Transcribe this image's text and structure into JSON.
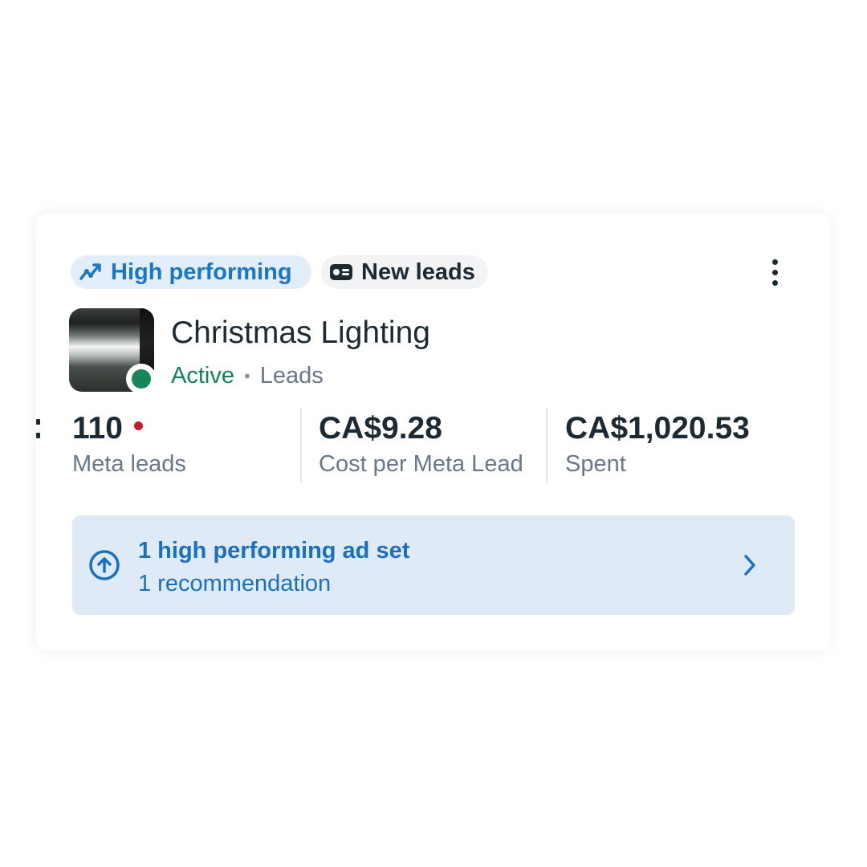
{
  "tags": {
    "high_performing": {
      "label": "High performing",
      "icon": "trend-up-icon",
      "color": "#1d76c2"
    },
    "new_leads": {
      "label": "New leads",
      "icon": "lead-card-icon"
    }
  },
  "menu": {
    "icon": "more-vertical-icon"
  },
  "campaign": {
    "title": "Christmas Lighting",
    "status": "Active",
    "separator": "•",
    "objective": "Leads",
    "status_color": "#17845a"
  },
  "metrics": [
    {
      "value": "110",
      "label": "Meta leads"
    },
    {
      "value": "CA$9.28",
      "label": "Cost per Meta Lead"
    },
    {
      "value": "CA$1,020.53",
      "label": "Spent"
    }
  ],
  "recommendation": {
    "title": "1 high performing ad set",
    "subtitle": "1 recommendation",
    "icon": "arrow-up-circle-icon",
    "chevron": "chevron-right-icon"
  }
}
